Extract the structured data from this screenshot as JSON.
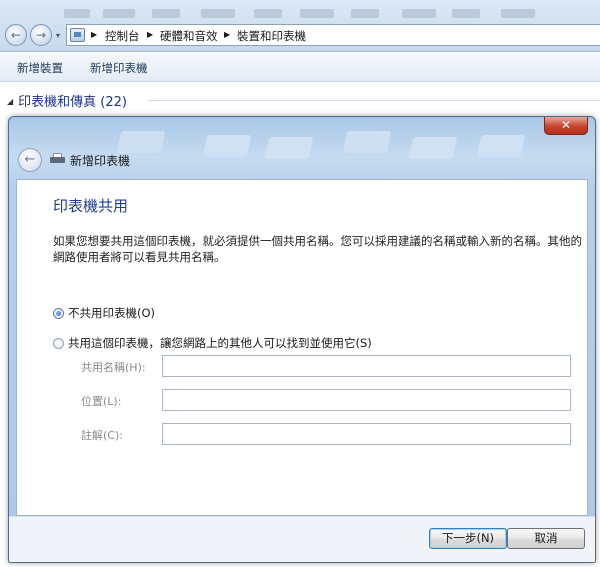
{
  "explorer": {
    "breadcrumbs": [
      "控制台",
      "硬體和音效",
      "裝置和印表機"
    ],
    "commands": [
      "新增裝置",
      "新增印表機"
    ],
    "group_header": "印表機和傳真 (22)"
  },
  "dialog": {
    "title": "新增印表機",
    "close_symbol": "✕",
    "heading": "印表機共用",
    "description": "如果您想要共用這個印表機，就必須提供一個共用名稱。您可以採用建議的名稱或輸入新的名稱。其他的網路使用者將可以看見共用名稱。",
    "options": [
      {
        "label": "不共用印表機(O)",
        "selected": true
      },
      {
        "label": "共用這個印表機，讓您網路上的其他人可以找到並使用它(S)",
        "selected": false
      }
    ],
    "fields": [
      {
        "label": "共用名稱(H):",
        "value": ""
      },
      {
        "label": "位置(L):",
        "value": ""
      },
      {
        "label": "註解(C):",
        "value": ""
      }
    ],
    "buttons": {
      "next": "下一步(N)",
      "cancel": "取消"
    }
  },
  "icons": [
    "back-arrow-icon",
    "forward-arrow-icon",
    "control-panel-icon",
    "printer-icon",
    "close-icon"
  ],
  "colors": {
    "heading": "#1e3e8c",
    "group_header": "#1e3287",
    "close_button": "#c7442d"
  }
}
